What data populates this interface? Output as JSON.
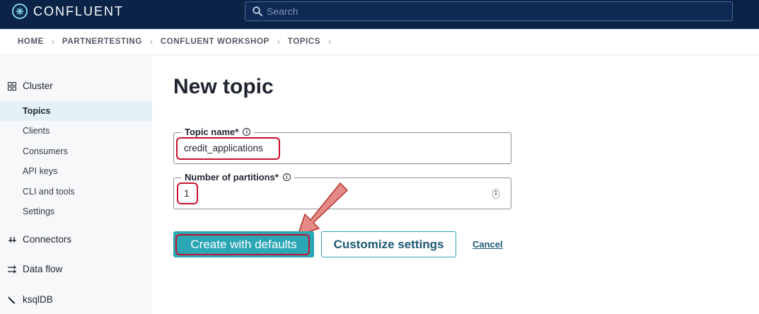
{
  "header": {
    "brand": "CONFLUENT",
    "search_placeholder": "Search"
  },
  "breadcrumb": [
    "HOME",
    "PARTNERTESTING",
    "CONFLUENT WORKSHOP",
    "TOPICS"
  ],
  "sidebar": {
    "cluster_label": "Cluster",
    "items": [
      "Topics",
      "Clients",
      "Consumers",
      "API keys",
      "CLI and tools",
      "Settings"
    ],
    "active_item": "Topics",
    "connectors_label": "Connectors",
    "dataflow_label": "Data flow",
    "ksqldb_label": "ksqlDB"
  },
  "form": {
    "title": "New topic",
    "topic_name_label": "Topic name*",
    "topic_name_value": "credit_applications",
    "partitions_label": "Number of partitions*",
    "partitions_value": "1",
    "info_glyph": "i"
  },
  "actions": {
    "create_label": "Create with defaults",
    "customize_label": "Customize settings",
    "cancel_label": "Cancel"
  },
  "colors": {
    "topbar": "#0b2347",
    "accent": "#2ba6b5",
    "highlight": "#c8102e",
    "arrow": "#d9534f"
  }
}
